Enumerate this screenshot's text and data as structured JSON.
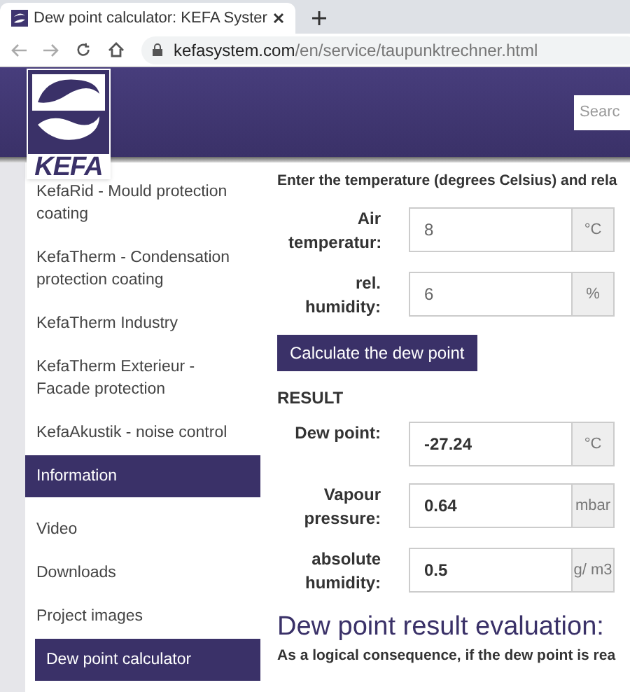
{
  "browser": {
    "tab_title": "Dew point calculator: KEFA Syster",
    "url_domain": "kefasystem.com",
    "url_path": "/en/service/taupunktrechner.html"
  },
  "header": {
    "logo_text": "KEFA",
    "search_placeholder": "Searc"
  },
  "sidebar": {
    "items": [
      {
        "label": "KefaRid - Mould protection coating",
        "kind": "link",
        "selected": false
      },
      {
        "label": "KefaTherm - Condensation protection coating",
        "kind": "link",
        "selected": false
      },
      {
        "label": "KefaTherm Industry",
        "kind": "link",
        "selected": false
      },
      {
        "label": "KefaTherm Exterieur - Facade protection",
        "kind": "link",
        "selected": false
      },
      {
        "label": "KefaAkustik - noise control",
        "kind": "link",
        "selected": false
      },
      {
        "label": "Information",
        "kind": "heading",
        "selected": false
      },
      {
        "label": "Video",
        "kind": "link",
        "selected": false
      },
      {
        "label": "Downloads",
        "kind": "link",
        "selected": false
      },
      {
        "label": "Project images",
        "kind": "link",
        "selected": false
      },
      {
        "label": "Dew point calculator",
        "kind": "link",
        "selected": true
      }
    ]
  },
  "form": {
    "intro": "Enter the temperature (degrees Celsius) and rela",
    "inputs": [
      {
        "label": "Air temperatur:",
        "value": "8",
        "unit": "°C"
      },
      {
        "label": "rel. humidity:",
        "value": "6",
        "unit": "%"
      }
    ],
    "button": "Calculate the dew point"
  },
  "result": {
    "title": "RESULT",
    "outputs": [
      {
        "label": "Dew point:",
        "value": "-27.24",
        "unit": "°C"
      },
      {
        "label": "Vapour pressure:",
        "value": "0.64",
        "unit": "mbar"
      },
      {
        "label": "absolute humidity:",
        "value": "0.5",
        "unit": "g/ m3"
      }
    ]
  },
  "evaluation": {
    "heading": "Dew point result evaluation:",
    "text": "As a logical consequence, if the dew point is rea"
  }
}
